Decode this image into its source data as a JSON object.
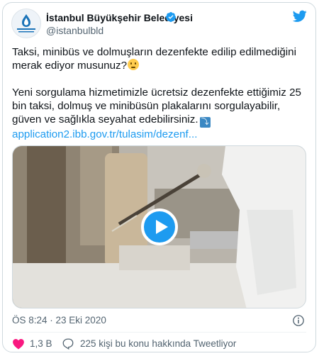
{
  "account": {
    "name": "İstanbul Büyükşehir Belediyesi",
    "handle": "@istanbulbld",
    "avatar_label": "İSTANBUL BÜYÜKŞEHİR BELEDİYESİ"
  },
  "tweet": {
    "line1": "Taksi, minibüs ve dolmuşların dezenfekte edilip edilmediğini",
    "line2": "merak ediyor musunuz?",
    "para2_line1": "Yeni sorgulama hizmetimizle ücretsiz dezenfekte ettiğimiz 25",
    "para2_line2": "bin taksi, dolmuş ve minibüsün plakalarını sorgulayabilir,",
    "para2_line3": "güven ve sağlıkla seyahat edebilirsiniz.",
    "arrow_glyph": "⤵",
    "link": "application2.ibb.gov.tr/tulasim/dezenf..."
  },
  "timestamp": "ÖS 8:24 · 23 Eki 2020",
  "actions": {
    "likes": "1,3 B",
    "talking": "225 kişi bu konu hakkında Tweetliyor"
  },
  "colors": {
    "accent": "#1d9bf0",
    "like": "#f91880",
    "muted": "#536471"
  },
  "icons": [
    "verified-badge-icon",
    "twitter-bird-icon",
    "play-icon",
    "info-icon",
    "heart-icon",
    "speech-bubble-icon",
    "thinking-face-emoji",
    "arrow-down-emoji"
  ]
}
